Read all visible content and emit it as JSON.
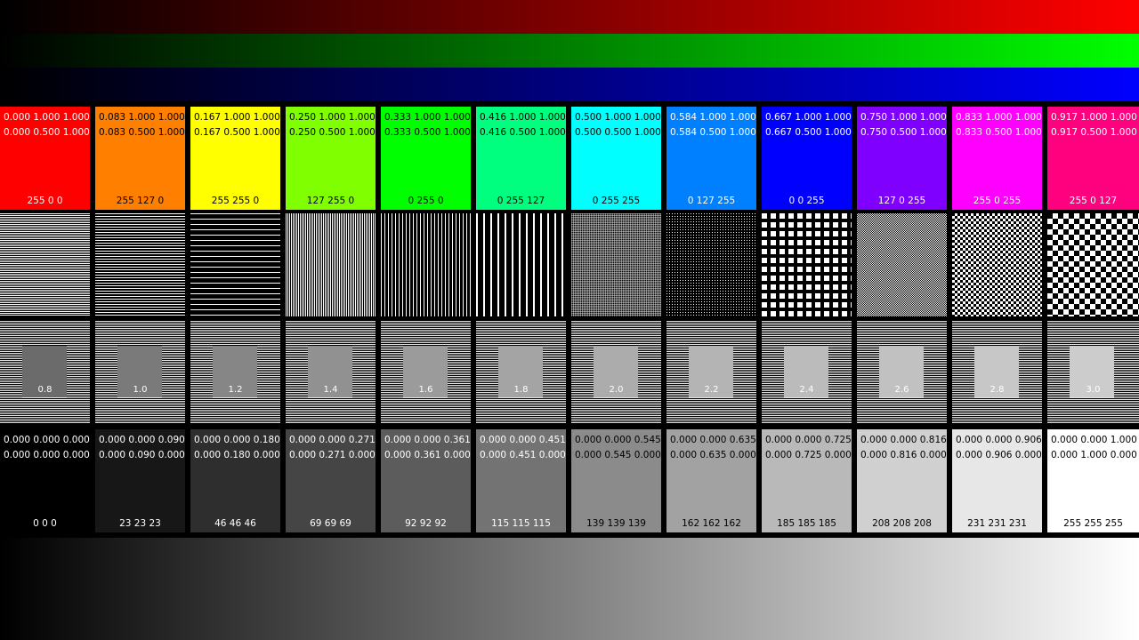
{
  "bands": {
    "red_color": "#ff0000",
    "green_color": "#00ff00",
    "blue_color": "#0000ff"
  },
  "hue_tiles": [
    {
      "line1": "0.000 1.000 1.000",
      "line2": "0.000 0.500 1.000",
      "rgb": "255 0 0",
      "color": "#ff0000",
      "text": "#ffffff"
    },
    {
      "line1": "0.083 1.000 1.000",
      "line2": "0.083 0.500 1.000",
      "rgb": "255 127 0",
      "color": "#ff7f00",
      "text": "#000000"
    },
    {
      "line1": "0.167 1.000 1.000",
      "line2": "0.167 0.500 1.000",
      "rgb": "255 255 0",
      "color": "#ffff00",
      "text": "#000000"
    },
    {
      "line1": "0.250 1.000 1.000",
      "line2": "0.250 0.500 1.000",
      "rgb": "127 255 0",
      "color": "#7fff00",
      "text": "#000000"
    },
    {
      "line1": "0.333 1.000 1.000",
      "line2": "0.333 0.500 1.000",
      "rgb": "0 255 0",
      "color": "#00ff00",
      "text": "#000000"
    },
    {
      "line1": "0.416 1.000 1.000",
      "line2": "0.416 0.500 1.000",
      "rgb": "0 255 127",
      "color": "#00ff7f",
      "text": "#000000"
    },
    {
      "line1": "0.500 1.000 1.000",
      "line2": "0.500 0.500 1.000",
      "rgb": "0 255 255",
      "color": "#00ffff",
      "text": "#000000"
    },
    {
      "line1": "0.584 1.000 1.000",
      "line2": "0.584 0.500 1.000",
      "rgb": "0 127 255",
      "color": "#007fff",
      "text": "#ffffff"
    },
    {
      "line1": "0.667 1.000 1.000",
      "line2": "0.667 0.500 1.000",
      "rgb": "0 0 255",
      "color": "#0000ff",
      "text": "#ffffff"
    },
    {
      "line1": "0.750 1.000 1.000",
      "line2": "0.750 0.500 1.000",
      "rgb": "127 0 255",
      "color": "#7f00ff",
      "text": "#ffffff"
    },
    {
      "line1": "0.833 1.000 1.000",
      "line2": "0.833 0.500 1.000",
      "rgb": "255 0 255",
      "color": "#ff00ff",
      "text": "#ffffff"
    },
    {
      "line1": "0.917 1.000 1.000",
      "line2": "0.917 0.500 1.000",
      "rgb": "255 0 127",
      "color": "#ff007f",
      "text": "#ffffff"
    }
  ],
  "gamma_tiles": [
    {
      "label": "0.8",
      "level": "#6b6b6b"
    },
    {
      "label": "1.0",
      "level": "#7a7a7a"
    },
    {
      "label": "1.2",
      "level": "#868686"
    },
    {
      "label": "1.4",
      "level": "#919191"
    },
    {
      "label": "1.6",
      "level": "#9b9b9b"
    },
    {
      "label": "1.8",
      "level": "#a4a4a4"
    },
    {
      "label": "2.0",
      "level": "#acacac"
    },
    {
      "label": "2.2",
      "level": "#b4b4b4"
    },
    {
      "label": "2.4",
      "level": "#bbbbbb"
    },
    {
      "label": "2.6",
      "level": "#c1c1c1"
    },
    {
      "label": "2.8",
      "level": "#c7c7c7"
    },
    {
      "label": "3.0",
      "level": "#cccccc"
    }
  ],
  "gray_tiles": [
    {
      "line1": "0.000 0.000 0.000",
      "line2": "0.000 0.000 0.000",
      "rgb": "0 0 0",
      "color": "#000000",
      "text": "#ffffff"
    },
    {
      "line1": "0.000 0.000 0.090",
      "line2": "0.000 0.090 0.000",
      "rgb": "23 23 23",
      "color": "#171717",
      "text": "#ffffff"
    },
    {
      "line1": "0.000 0.000 0.180",
      "line2": "0.000 0.180 0.000",
      "rgb": "46 46 46",
      "color": "#2e2e2e",
      "text": "#ffffff"
    },
    {
      "line1": "0.000 0.000 0.271",
      "line2": "0.000 0.271 0.000",
      "rgb": "69 69 69",
      "color": "#454545",
      "text": "#ffffff"
    },
    {
      "line1": "0.000 0.000 0.361",
      "line2": "0.000 0.361 0.000",
      "rgb": "92 92 92",
      "color": "#5c5c5c",
      "text": "#ffffff"
    },
    {
      "line1": "0.000 0.000 0.451",
      "line2": "0.000 0.451 0.000",
      "rgb": "115 115 115",
      "color": "#737373",
      "text": "#ffffff"
    },
    {
      "line1": "0.000 0.000 0.545",
      "line2": "0.000 0.545 0.000",
      "rgb": "139 139 139",
      "color": "#8b8b8b",
      "text": "#000000"
    },
    {
      "line1": "0.000 0.000 0.635",
      "line2": "0.000 0.635 0.000",
      "rgb": "162 162 162",
      "color": "#a2a2a2",
      "text": "#000000"
    },
    {
      "line1": "0.000 0.000 0.725",
      "line2": "0.000 0.725 0.000",
      "rgb": "185 185 185",
      "color": "#b9b9b9",
      "text": "#000000"
    },
    {
      "line1": "0.000 0.000 0.816",
      "line2": "0.000 0.816 0.000",
      "rgb": "208 208 208",
      "color": "#d0d0d0",
      "text": "#000000"
    },
    {
      "line1": "0.000 0.000 0.906",
      "line2": "0.000 0.906 0.000",
      "rgb": "231 231 231",
      "color": "#e7e7e7",
      "text": "#000000"
    },
    {
      "line1": "0.000 0.000 1.000",
      "line2": "0.000 1.000 0.000",
      "rgb": "255 255 255",
      "color": "#ffffff",
      "text": "#000000"
    }
  ],
  "pattern_tiles": [
    "fine-horizontal-lines",
    "medium-horizontal-lines",
    "coarse-horizontal-lines",
    "fine-vertical-lines",
    "medium-vertical-lines",
    "coarse-vertical-lines",
    "fine-grid",
    "medium-grid",
    "coarse-dots",
    "fine-checkerboard",
    "medium-checkerboard",
    "coarse-checkerboard"
  ]
}
